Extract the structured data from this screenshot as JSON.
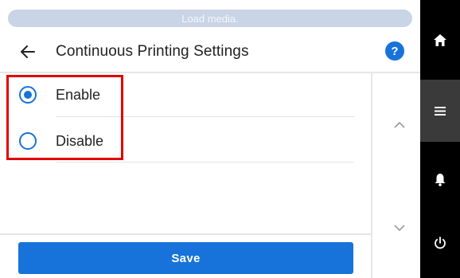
{
  "status": {
    "message": "Load media."
  },
  "header": {
    "title": "Continuous Printing Settings",
    "back_icon": "arrow-left-icon",
    "help_label": "?"
  },
  "options": [
    {
      "label": "Enable",
      "selected": true
    },
    {
      "label": "Disable",
      "selected": false
    }
  ],
  "footer": {
    "save_label": "Save"
  },
  "sidebar": {
    "items": [
      "home-icon",
      "menu-icon",
      "bell-icon",
      "power-icon"
    ],
    "active": "menu-icon"
  },
  "colors": {
    "accent": "#1773d9",
    "highlight": "#e00000",
    "sidebar": "#000000",
    "status_bar": "#c9d4e6"
  }
}
